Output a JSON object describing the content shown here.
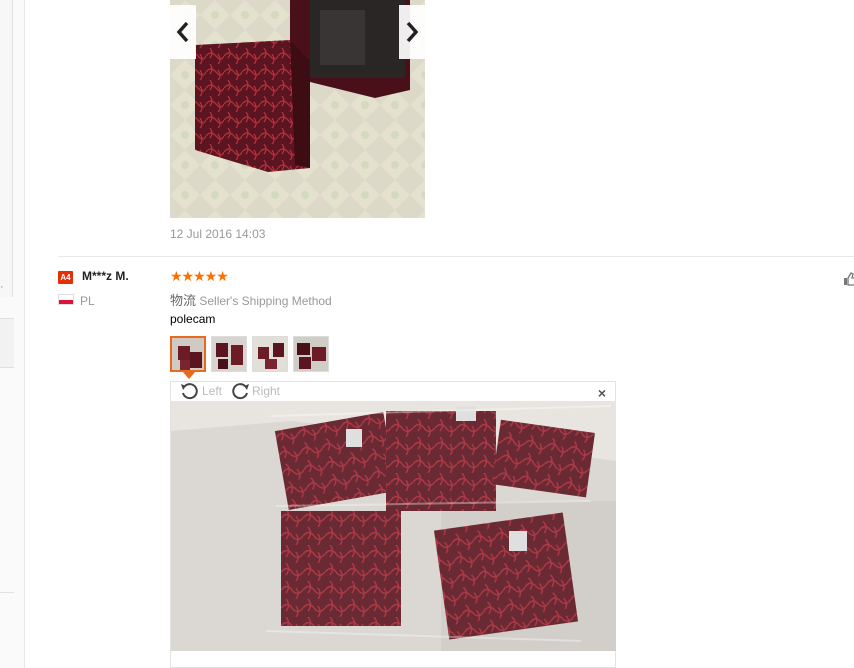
{
  "top_review": {
    "date": "12 Jul 2016 14:03",
    "nav": {
      "prev": "prev-arrow",
      "next": "next-arrow"
    }
  },
  "review": {
    "country_badge": "A4",
    "user_name": "M***z M.",
    "country_code": "PL",
    "rating": 5,
    "stars": "★★★★★",
    "shipping_prefix": "物流",
    "shipping_method": "Seller's Shipping Method",
    "text": "polecam",
    "viewer": {
      "rotate_left": "Left",
      "rotate_right": "Right",
      "close": "×"
    }
  },
  "colors": {
    "accent": "#ff6f00",
    "thumb_active": "#e96a1b",
    "badge": "#e62e04"
  }
}
